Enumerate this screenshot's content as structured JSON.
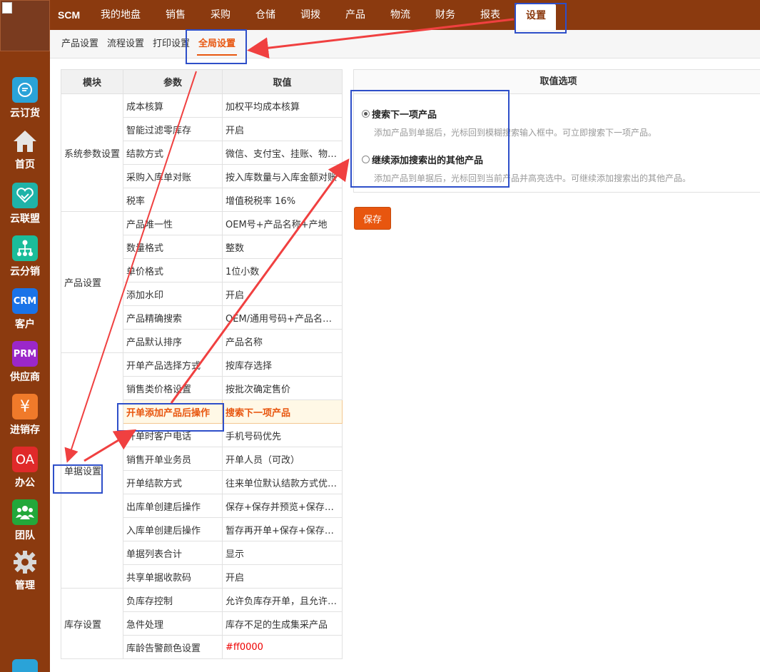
{
  "colors": {
    "brand": "#8b3a0f",
    "accent": "#e8560f",
    "annotation": "#2e4fc9",
    "arrow": "#f04040"
  },
  "sidebar": {
    "items": [
      {
        "label": "云订货",
        "icon": "chat-bubble-icon",
        "bg": "#2aa3d8"
      },
      {
        "label": "首页",
        "icon": "home-icon",
        "bg": ""
      },
      {
        "label": "云联盟",
        "icon": "handshake-heart-icon",
        "bg": "#1fb3a8"
      },
      {
        "label": "云分销",
        "icon": "network-tree-icon",
        "bg": "#1bbd9a"
      },
      {
        "label": "客户",
        "icon": "crm-icon",
        "icon_text": "CRM",
        "bg": "#1a73e8"
      },
      {
        "label": "供应商",
        "icon": "prm-icon",
        "icon_text": "PRM",
        "bg": "#9b27c9"
      },
      {
        "label": "进销存",
        "icon": "yen-icon",
        "icon_text": "¥",
        "bg": "#f07a2a"
      },
      {
        "label": "办公",
        "icon": "oa-icon",
        "icon_text": "OA",
        "bg": "#e02a2a"
      },
      {
        "label": "团队",
        "icon": "team-icon",
        "bg": "#22a83a"
      },
      {
        "label": "管理",
        "icon": "gear-icon",
        "bg": ""
      }
    ]
  },
  "topnav": {
    "brand": "SCM",
    "items": [
      "我的地盘",
      "销售",
      "采购",
      "仓储",
      "调拨",
      "产品",
      "物流",
      "财务",
      "报表"
    ],
    "active": "设置"
  },
  "subnav": {
    "items": [
      "产品设置",
      "流程设置",
      "打印设置"
    ],
    "active": "全局设置"
  },
  "table": {
    "headers": [
      "模块",
      "参数",
      "取值"
    ],
    "groups": [
      {
        "module": "系统参数设置",
        "rows": [
          [
            "成本核算",
            "加权平均成本核算"
          ],
          [
            "智能过滤零库存",
            "开启"
          ],
          [
            "结款方式",
            "微信、支付宝、挂账、物…"
          ],
          [
            "采购入库单对账",
            "按入库数量与入库金额对账"
          ],
          [
            "税率",
            "增值税税率 16%"
          ]
        ]
      },
      {
        "module": "产品设置",
        "rows": [
          [
            "产品唯一性",
            "OEM号+产品名称+产地"
          ],
          [
            "数量格式",
            "整数"
          ],
          [
            "单价格式",
            "1位小数"
          ],
          [
            "添加水印",
            "开启"
          ],
          [
            "产品精确搜索",
            "OEM/通用号码+产品名称…"
          ],
          [
            "产品默认排序",
            "产品名称"
          ]
        ]
      },
      {
        "module": "单据设置",
        "rows": [
          [
            "开单产品选择方式",
            "按库存选择"
          ],
          [
            "销售类价格设置",
            "按批次确定售价"
          ],
          [
            "开单添加产品后操作",
            "搜索下一项产品"
          ],
          [
            "开单时客户电话",
            "手机号码优先"
          ],
          [
            "销售开单业务员",
            "开单人员（可改）"
          ],
          [
            "开单结款方式",
            "往来单位默认结款方式优…"
          ],
          [
            "出库单创建后操作",
            "保存+保存并预览+保存并…"
          ],
          [
            "入库单创建后操作",
            "暂存再开单+保存+保存并…"
          ],
          [
            "单据列表合计",
            "显示"
          ],
          [
            "共享单据收款码",
            "开启"
          ]
        ]
      },
      {
        "module": "库存设置",
        "rows": [
          [
            "负库存控制",
            "允许负库存开单，且允许…"
          ],
          [
            "急件处理",
            "库存不足的生成集采产品"
          ],
          [
            "库龄告警颜色设置",
            "#ff0000"
          ]
        ]
      }
    ]
  },
  "options": {
    "header": "取值选项",
    "items": [
      {
        "title": "搜索下一项产品",
        "desc": "添加产品到单据后，光标回到模糊搜索输入框中。可立即搜索下一项产品。",
        "checked": true
      },
      {
        "title": "继续添加搜索出的其他产品",
        "desc": "添加产品到单据后，光标回到当前产品并高亮选中。可继续添加搜索出的其他产品。",
        "checked": false
      }
    ]
  },
  "save_label": "保存"
}
